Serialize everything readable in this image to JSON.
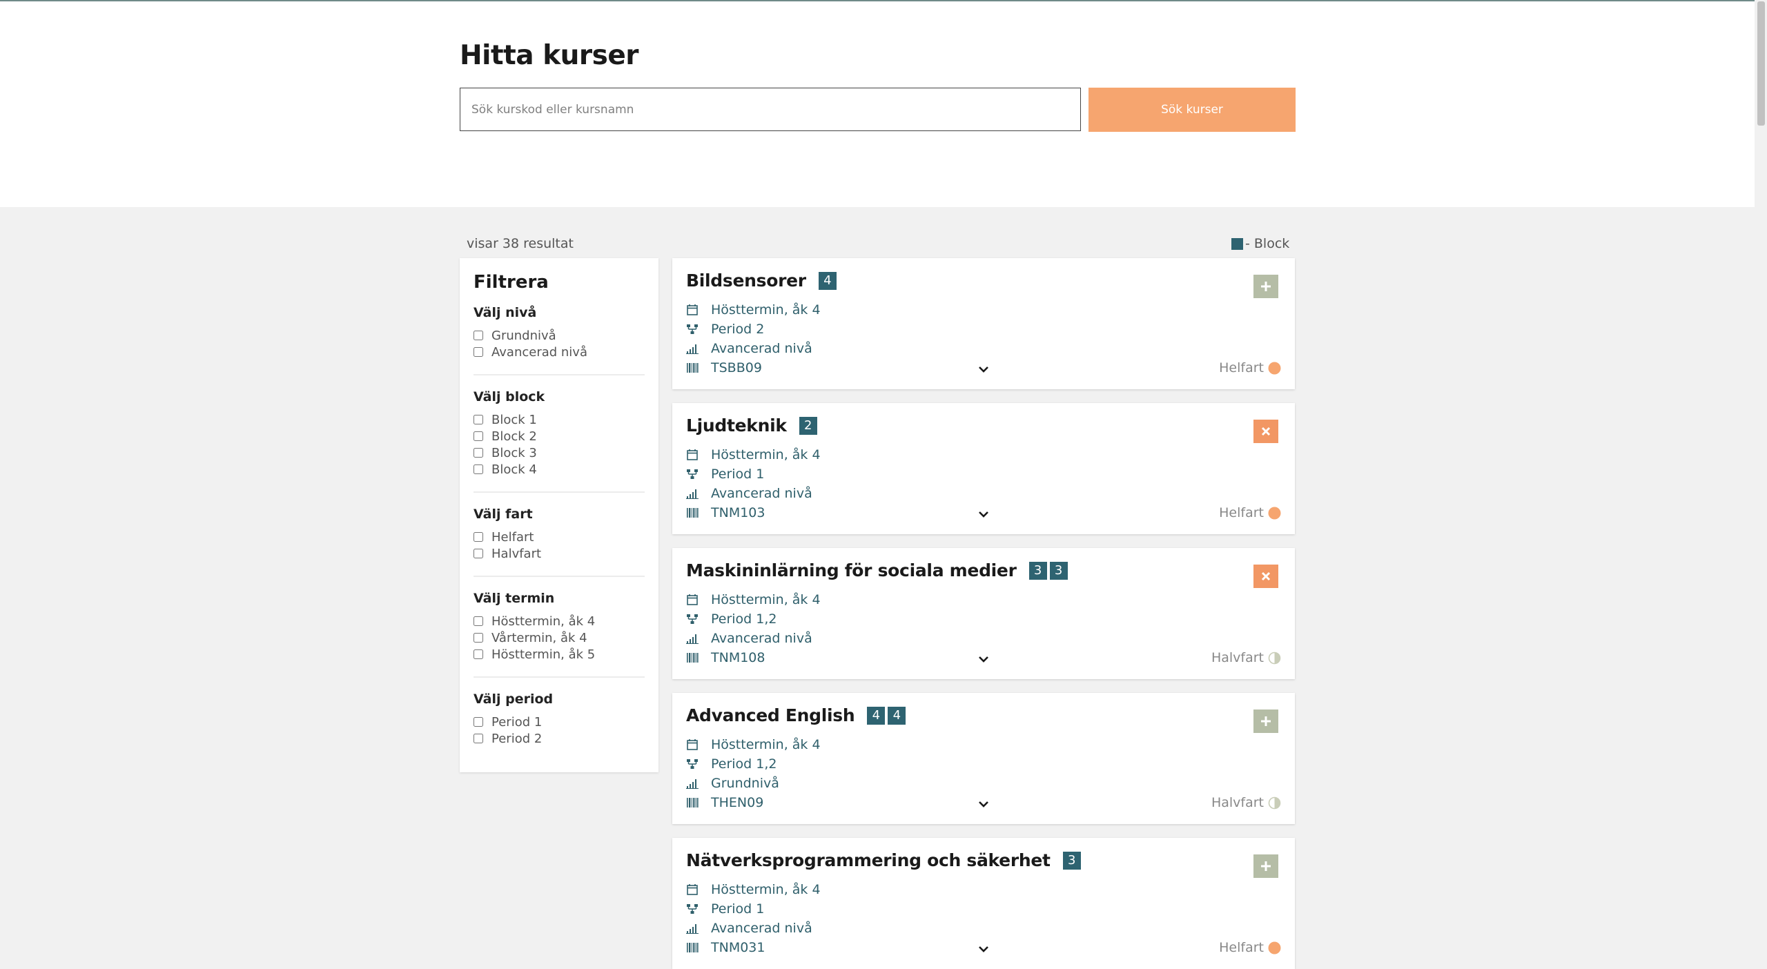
{
  "header": {
    "title": "Hitta kurser",
    "search_placeholder": "Sök kurskod eller kursnamn",
    "search_button": "Sök kurser"
  },
  "results": {
    "count_text": "visar 38 resultat",
    "legend_label": "- Block"
  },
  "filters": {
    "title": "Filtrera",
    "groups": [
      {
        "title": "Välj nivå",
        "options": [
          "Grundnivå",
          "Avancerad nivå"
        ]
      },
      {
        "title": "Välj block",
        "options": [
          "Block 1",
          "Block 2",
          "Block 3",
          "Block 4"
        ]
      },
      {
        "title": "Välj fart",
        "options": [
          "Helfart",
          "Halvfart"
        ]
      },
      {
        "title": "Välj termin",
        "options": [
          "Hösttermin, åk 4",
          "Vårtermin, åk 4",
          "Hösttermin, åk 5"
        ]
      },
      {
        "title": "Välj period",
        "options": [
          "Period 1",
          "Period 2"
        ]
      }
    ]
  },
  "courses": [
    {
      "title": "Bildsensorer",
      "blocks": [
        "4"
      ],
      "term": "Hösttermin, åk 4",
      "period": "Period 2",
      "level": "Avancerad nivå",
      "code": "TSBB09",
      "speed": "Helfart",
      "action": "add"
    },
    {
      "title": "Ljudteknik",
      "blocks": [
        "2"
      ],
      "term": "Hösttermin, åk 4",
      "period": "Period 1",
      "level": "Avancerad nivå",
      "code": "TNM103",
      "speed": "Helfart",
      "action": "remove"
    },
    {
      "title": "Maskininlärning för sociala medier",
      "blocks": [
        "3",
        "3"
      ],
      "term": "Hösttermin, åk 4",
      "period": "Period 1,2",
      "level": "Avancerad nivå",
      "code": "TNM108",
      "speed": "Halvfart",
      "action": "remove"
    },
    {
      "title": "Advanced English",
      "blocks": [
        "4",
        "4"
      ],
      "term": "Hösttermin, åk 4",
      "period": "Period 1,2",
      "level": "Grundnivå",
      "code": "THEN09",
      "speed": "Halvfart",
      "action": "add"
    },
    {
      "title": "Nätverksprogrammering och säkerhet",
      "blocks": [
        "3"
      ],
      "term": "Hösttermin, åk 4",
      "period": "Period 1",
      "level": "Avancerad nivå",
      "code": "TNM031",
      "speed": "Helfart",
      "action": "add"
    }
  ],
  "colors": {
    "block_badge": "#2e6371",
    "search_button": "#f6a56f",
    "add_button": "#b5bda6",
    "remove_button": "#f29764",
    "helfart_dot": "#f6a56f",
    "info_text": "#2f5f6b"
  }
}
